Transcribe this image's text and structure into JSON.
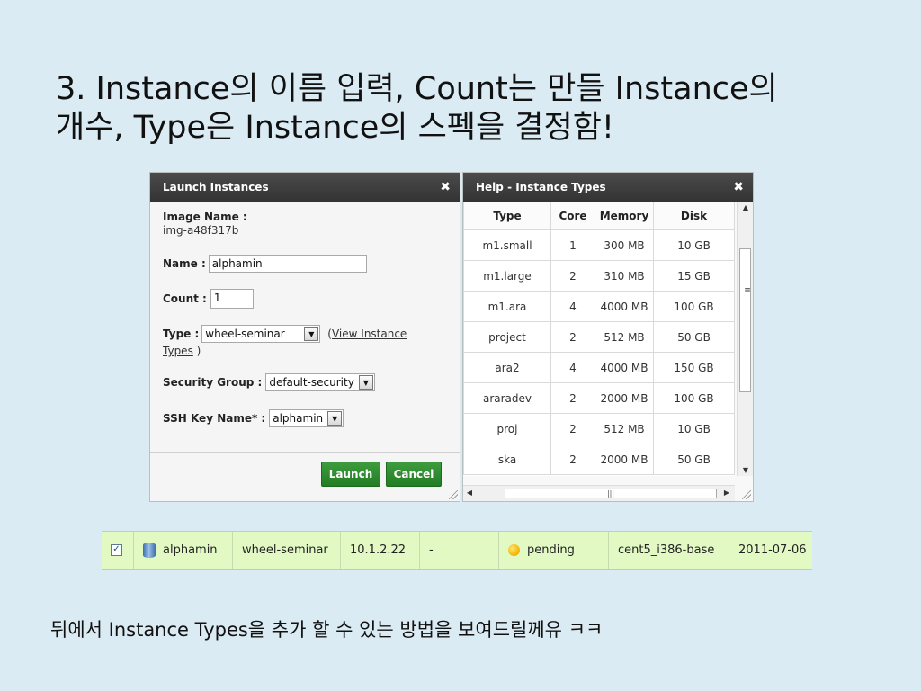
{
  "slide": {
    "title_line1": "3. Instance의 이름 입력, Count는 만들 Instance의",
    "title_line2": "개수, Type은 Instance의 스펙을 결정함!",
    "footer_note": "뒤에서 Instance Types을 추가 할 수 있는 방법을 보여드릴께유 ㅋㅋ"
  },
  "launch_dialog": {
    "title": "Launch Instances",
    "image_name_label": "Image Name :",
    "image_name_value": "img-a48f317b",
    "name_label": "Name :",
    "name_value": "alphamin",
    "count_label": "Count :",
    "count_value": "1",
    "type_label": "Type :",
    "type_value": "wheel-seminar",
    "view_types_prefix": "( ",
    "view_types_link_a": "View Instance",
    "view_types_link_b": "Types",
    "view_types_suffix": " )",
    "security_group_label": "Security Group :",
    "security_group_value": "default-security",
    "ssh_key_label": "SSH Key Name* :",
    "ssh_key_value": "alphamin",
    "launch_button": "Launch",
    "cancel_button": "Cancel",
    "button_color": "#2e8b2e"
  },
  "help_dialog": {
    "title": "Help - Instance Types",
    "columns": [
      "Type",
      "Core",
      "Memory",
      "Disk"
    ],
    "rows": [
      [
        "m1.small",
        "1",
        "300 MB",
        "10 GB"
      ],
      [
        "m1.large",
        "2",
        "310 MB",
        "15 GB"
      ],
      [
        "m1.ara",
        "4",
        "4000 MB",
        "100 GB"
      ],
      [
        "project",
        "2",
        "512 MB",
        "50 GB"
      ],
      [
        "ara2",
        "4",
        "4000 MB",
        "150 GB"
      ],
      [
        "araradev",
        "2",
        "2000 MB",
        "100 GB"
      ],
      [
        "proj",
        "2",
        "512 MB",
        "10 GB"
      ],
      [
        "ska",
        "2",
        "2000 MB",
        "50 GB"
      ]
    ]
  },
  "instance_row": {
    "checked": "✓",
    "name": "alphamin",
    "type": "wheel-seminar",
    "ip": "10.1.2.22",
    "extra": "-",
    "status": "pending",
    "image": "cent5_i386-base",
    "date": "2011-07-06",
    "row_color": "#e2f9c4"
  },
  "icons": [
    "close-icon",
    "dropdown-arrow-icon",
    "checkbox-icon",
    "database-icon",
    "pending-status-icon"
  ]
}
